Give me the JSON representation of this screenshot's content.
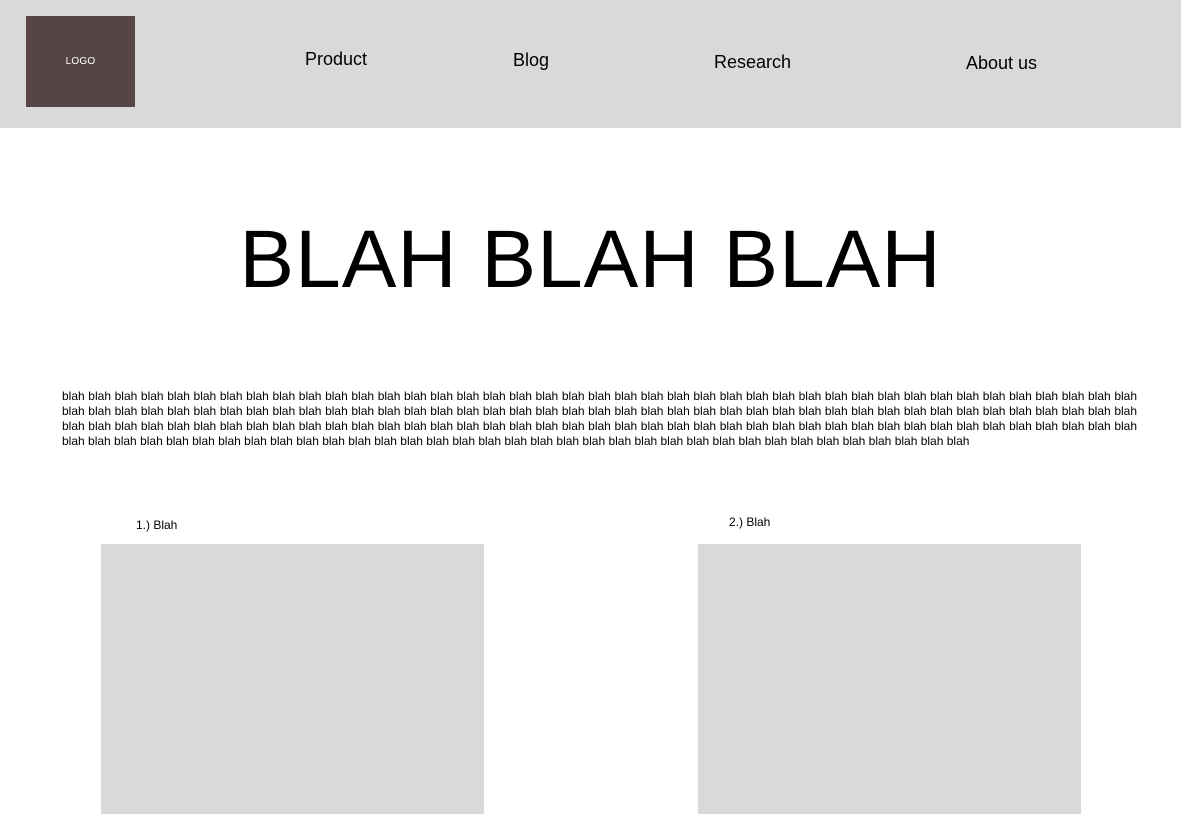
{
  "header": {
    "logo_label": "LOGO",
    "nav": [
      {
        "label": "Product"
      },
      {
        "label": "Blog"
      },
      {
        "label": "Research"
      },
      {
        "label": "About us"
      }
    ]
  },
  "hero": {
    "title": "BLAH BLAH BLAH",
    "body": "blah blah blah blah blah blah blah blah blah blah blah blah blah blah blah blah blah blah blah blah blah blah blah blah blah blah blah blah blah blah blah blah blah blah blah blah blah blah blah blah blah blah blah blah blah blah blah blah blah blah blah blah blah blah blah blah blah blah blah blah blah blah blah blah blah blah blah blah blah blah blah blah blah blah blah blah blah blah blah blah blah blah blah blah blah blah blah blah blah blah blah blah blah blah blah blah blah blah blah blah blah blah blah blah blah blah blah blah blah blah blah blah blah blah blah blah blah blah blah blah blah blah blah blah blah blah blah blah blah blah blah blah blah blah blah blah blah blah blah blah blah blah blah blah blah blah blah blah blah blah blah blah blah blah blah blah blah blah"
  },
  "cards": [
    {
      "label": "1.) Blah"
    },
    {
      "label": "2.) Blah"
    }
  ],
  "colors": {
    "topbar": "#d9d9d9",
    "logo": "#574545",
    "placeholder": "#d9d9d9"
  }
}
